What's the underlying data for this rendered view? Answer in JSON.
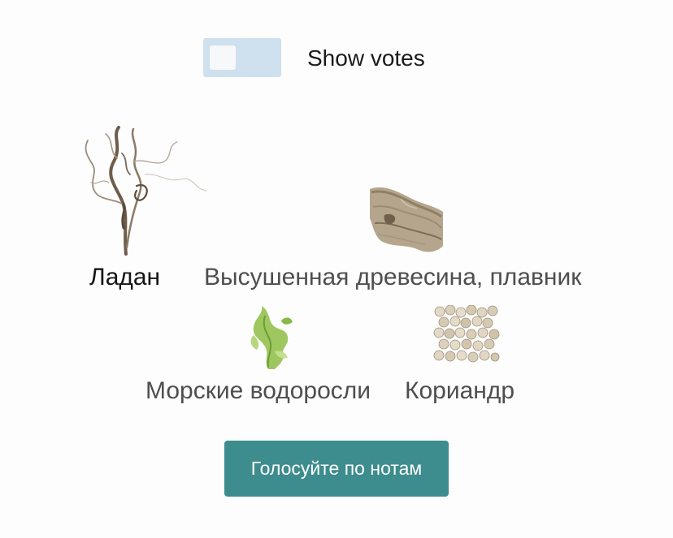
{
  "toggle": {
    "label": "Show votes",
    "checked": false
  },
  "notes": [
    {
      "label": "Ладан",
      "icon": "smoke-icon"
    },
    {
      "label": "Высушенная древесина, плавник",
      "icon": "driftwood-icon"
    },
    {
      "label": "Морские водоросли",
      "icon": "seaweed-icon"
    },
    {
      "label": "Кориандр",
      "icon": "coriander-seeds-icon"
    }
  ],
  "vote_button": {
    "label": "Голосуйте по нотам"
  },
  "colors": {
    "toggle_bg": "#cfe0ee",
    "button_bg": "#3d8c8e"
  }
}
